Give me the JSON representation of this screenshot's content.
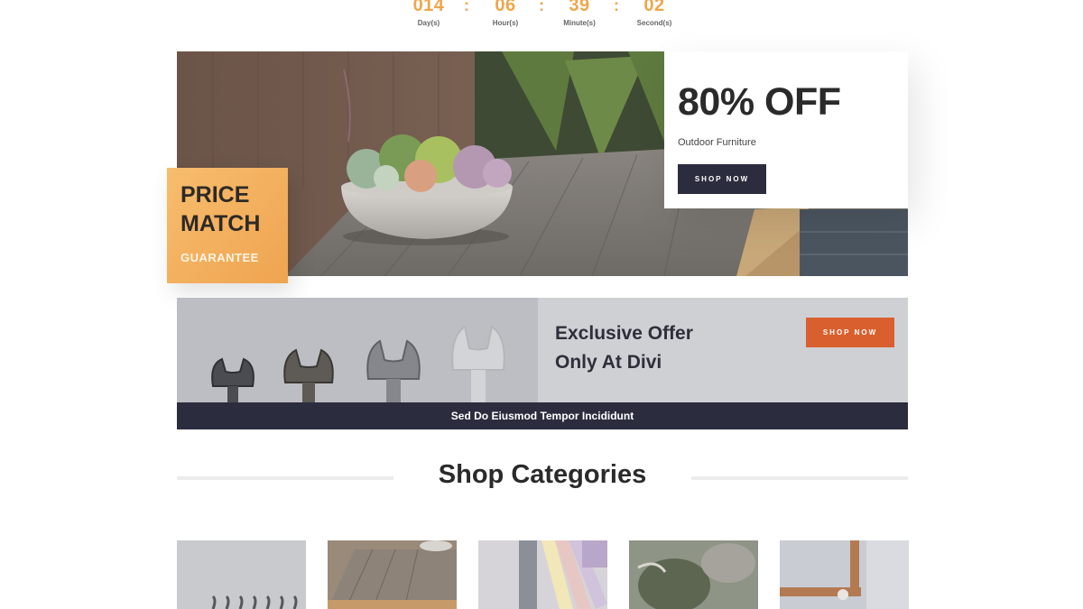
{
  "countdown": {
    "units": [
      {
        "value": "014",
        "label": "Day(s)"
      },
      {
        "value": "06",
        "label": "Hour(s)"
      },
      {
        "value": "39",
        "label": "Minute(s)"
      },
      {
        "value": "02",
        "label": "Second(s)"
      }
    ],
    "separator": ":"
  },
  "hero": {
    "discount": "80% OFF",
    "category": "Outdoor Furniture",
    "cta": "SHOP NOW"
  },
  "price_match": {
    "line1": "PRICE",
    "line2": "MATCH",
    "line3": "GUARANTEE"
  },
  "offer": {
    "title_line1": "Exclusive Offer",
    "title_line2": "Only At Divi",
    "cta": "SHOP NOW",
    "bar_text": "Sed Do Eiusmod Tempor Incididunt"
  },
  "categories": {
    "title": "Shop Categories"
  },
  "colors": {
    "accent_orange": "#f0a54a",
    "button_dark": "#2b2d3e",
    "button_orange": "#d9602e"
  }
}
